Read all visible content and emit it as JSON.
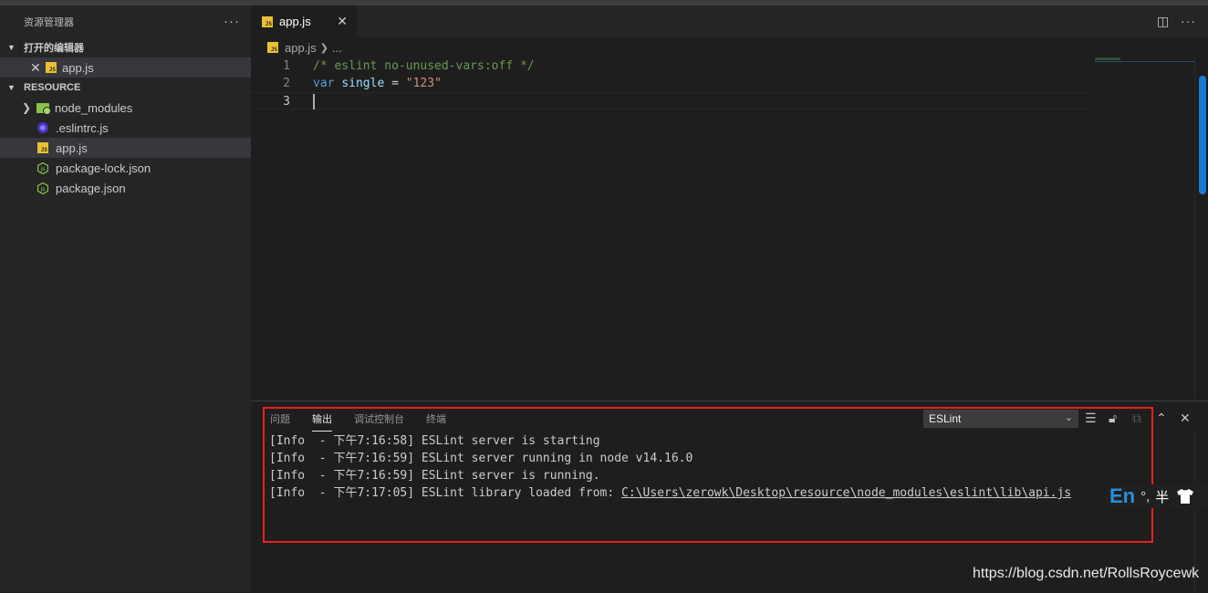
{
  "sidebar": {
    "title": "资源管理器",
    "more": "···",
    "open_editors": {
      "header": "打开的编辑器",
      "items": [
        {
          "name": "app.js"
        }
      ]
    },
    "folder": {
      "header": "RESOURCE",
      "items": [
        {
          "name": "node_modules",
          "icon": "folder-icon"
        },
        {
          "name": ".eslintrc.js",
          "icon": "eslint-icon"
        },
        {
          "name": "app.js",
          "icon": "js-icon"
        },
        {
          "name": "package-lock.json",
          "icon": "node-icon"
        },
        {
          "name": "package.json",
          "icon": "node-icon"
        }
      ]
    }
  },
  "editor": {
    "tab_label": "app.js",
    "breadcrumb": [
      "app.js",
      "..."
    ],
    "line_numbers": [
      "1",
      "2",
      "3"
    ],
    "code": {
      "line1": "/* eslint no-unused-vars:off */",
      "kw": "var",
      "ident": "single",
      "op": "=",
      "str": "\"123\""
    }
  },
  "panel": {
    "tabs": [
      "问题",
      "输出",
      "调试控制台",
      "终端"
    ],
    "active_tab": "输出",
    "channel": "ESLint",
    "output": [
      "[Info  - 下午7:16:58] ESLint server is starting",
      "[Info  - 下午7:16:59] ESLint server running in node v14.16.0",
      "[Info  - 下午7:16:59] ESLint server is running."
    ],
    "output_last_prefix": "[Info  - 下午7:17:05] ESLint library loaded from: ",
    "output_last_path": "C:\\Users\\zerowk\\Desktop\\resource\\node_modules\\eslint\\lib\\api.js"
  },
  "ime": {
    "lang": "En",
    "dots": "°,",
    "width": "半"
  },
  "watermark": "https://blog.csdn.net/RollsRoycewk",
  "colors": {
    "accent": "#1a7ad0",
    "highlight": "#e5211d",
    "js": "#e8c134"
  }
}
